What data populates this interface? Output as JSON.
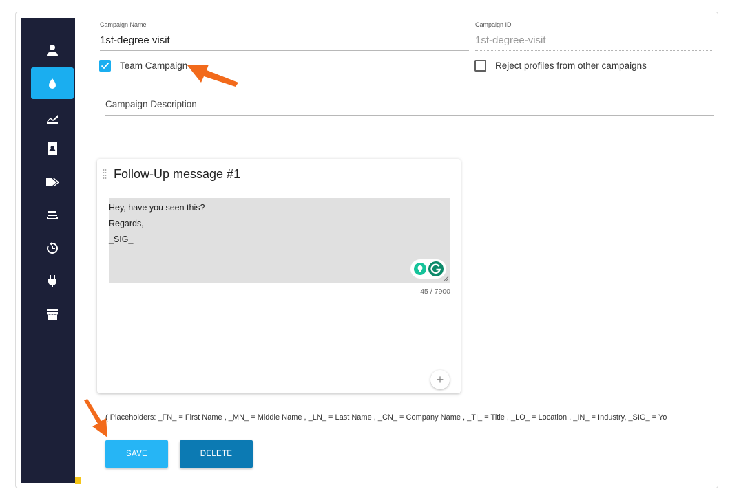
{
  "sidebar": {
    "items": [
      {
        "icon": "person-icon",
        "active": false
      },
      {
        "icon": "droplet-icon",
        "active": true
      },
      {
        "icon": "chart-area-icon",
        "active": false
      },
      {
        "icon": "contact-card-icon",
        "active": false
      },
      {
        "icon": "tags-icon",
        "active": false
      },
      {
        "icon": "list-icon",
        "active": false
      },
      {
        "icon": "history-icon",
        "active": false
      },
      {
        "icon": "plug-icon",
        "active": false
      },
      {
        "icon": "storefront-icon",
        "active": false
      }
    ]
  },
  "form": {
    "campaign_name_label": "Campaign Name",
    "campaign_name_value": "1st-degree visit",
    "campaign_id_label": "Campaign ID",
    "campaign_id_value": "1st-degree-visit",
    "team_campaign_label": "Team Campaign",
    "team_campaign_checked": true,
    "reject_profiles_label": "Reject profiles from other campaigns",
    "reject_profiles_checked": false,
    "description_placeholder": "Campaign Description"
  },
  "followup": {
    "title": "Follow-Up message #1",
    "message_lines": [
      "Hey, have you seen this?",
      "Regards,",
      "_SIG_"
    ],
    "char_count": "45 / 7900"
  },
  "placeholders_text": "( Placeholders: _FN_ = First Name , _MN_ = Middle Name , _LN_ = Last Name , _CN_ = Company Name , _TI_ = Title , _LO_ = Location , _IN_ = Industry, _SIG_ = Yo",
  "buttons": {
    "save": "SAVE",
    "delete": "DELETE"
  },
  "colors": {
    "sidebar_bg": "#1c2038",
    "accent": "#1aaef0",
    "save_button": "#26b5f5",
    "delete_button": "#0c7ab3",
    "annotation_arrow": "#f26a1b"
  }
}
